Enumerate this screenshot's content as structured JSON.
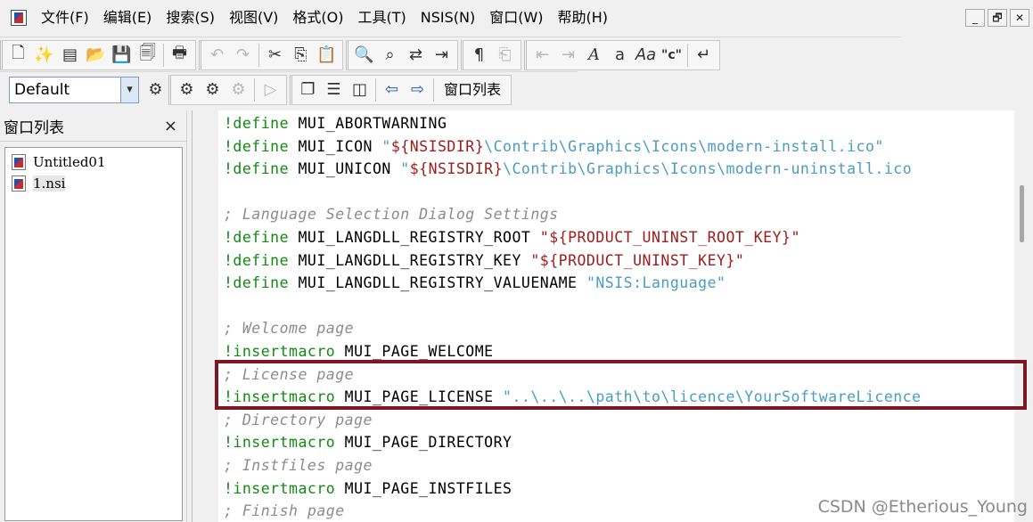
{
  "menubar": {
    "items": [
      "文件(F)",
      "编辑(E)",
      "搜索(S)",
      "视图(V)",
      "格式(O)",
      "工具(T)",
      "NSIS(N)",
      "窗口(W)",
      "帮助(H)"
    ],
    "window_controls": [
      "_",
      "🗗",
      "✕"
    ]
  },
  "toolbar2": {
    "combo_value": "Default",
    "window_list_label": "窗口列表"
  },
  "left_panel": {
    "title": "窗口列表",
    "close": "×",
    "files": [
      "Untitled01",
      "1.nsi"
    ]
  },
  "editor": {
    "lines": [
      [
        [
          "kw",
          "!define"
        ],
        [
          "id",
          " MUI_ABORTWARNING"
        ]
      ],
      [
        [
          "kw",
          "!define"
        ],
        [
          "id",
          " MUI_ICON "
        ],
        [
          "str",
          "\""
        ],
        [
          "var",
          "${NSISDIR}"
        ],
        [
          "str",
          "\\Contrib\\Graphics\\Icons\\modern-install.ico\""
        ]
      ],
      [
        [
          "kw",
          "!define"
        ],
        [
          "id",
          " MUI_UNICON "
        ],
        [
          "str",
          "\""
        ],
        [
          "var",
          "${NSISDIR}"
        ],
        [
          "str",
          "\\Contrib\\Graphics\\Icons\\modern-uninstall.ico"
        ]
      ],
      [],
      [
        [
          "cmt",
          "; Language Selection Dialog Settings"
        ]
      ],
      [
        [
          "kw",
          "!define"
        ],
        [
          "id",
          " MUI_LANGDLL_REGISTRY_ROOT "
        ],
        [
          "var",
          "\"${PRODUCT_UNINST_ROOT_KEY}\""
        ]
      ],
      [
        [
          "kw",
          "!define"
        ],
        [
          "id",
          " MUI_LANGDLL_REGISTRY_KEY "
        ],
        [
          "var",
          "\"${PRODUCT_UNINST_KEY}\""
        ]
      ],
      [
        [
          "kw",
          "!define"
        ],
        [
          "id",
          " MUI_LANGDLL_REGISTRY_VALUENAME "
        ],
        [
          "str",
          "\"NSIS:Language\""
        ]
      ],
      [],
      [
        [
          "cmt",
          "; Welcome page"
        ]
      ],
      [
        [
          "kw",
          "!insertmacro"
        ],
        [
          "id",
          " MUI_PAGE_WELCOME"
        ]
      ],
      [
        [
          "cmt",
          "; License page"
        ]
      ],
      [
        [
          "kw",
          "!insertmacro"
        ],
        [
          "id",
          " MUI_PAGE_LICENSE "
        ],
        [
          "str",
          "\"..\\..\\..\\path\\to\\licence\\YourSoftwareLicence"
        ]
      ],
      [
        [
          "cmt",
          "; Directory page"
        ]
      ],
      [
        [
          "kw",
          "!insertmacro"
        ],
        [
          "id",
          " MUI_PAGE_DIRECTORY"
        ]
      ],
      [
        [
          "cmt",
          "; Instfiles page"
        ]
      ],
      [
        [
          "kw",
          "!insertmacro"
        ],
        [
          "id",
          " MUI_PAGE_INSTFILES"
        ]
      ],
      [
        [
          "cmt",
          "; Finish page"
        ]
      ]
    ]
  },
  "colors": {
    "keyword": "#128a12",
    "string": "#4a9cc0",
    "variable": "#a01c1c",
    "comment": "#8c8c8c",
    "highlight_box": "#7e1624"
  },
  "watermark": "CSDN @Etherious_Young"
}
